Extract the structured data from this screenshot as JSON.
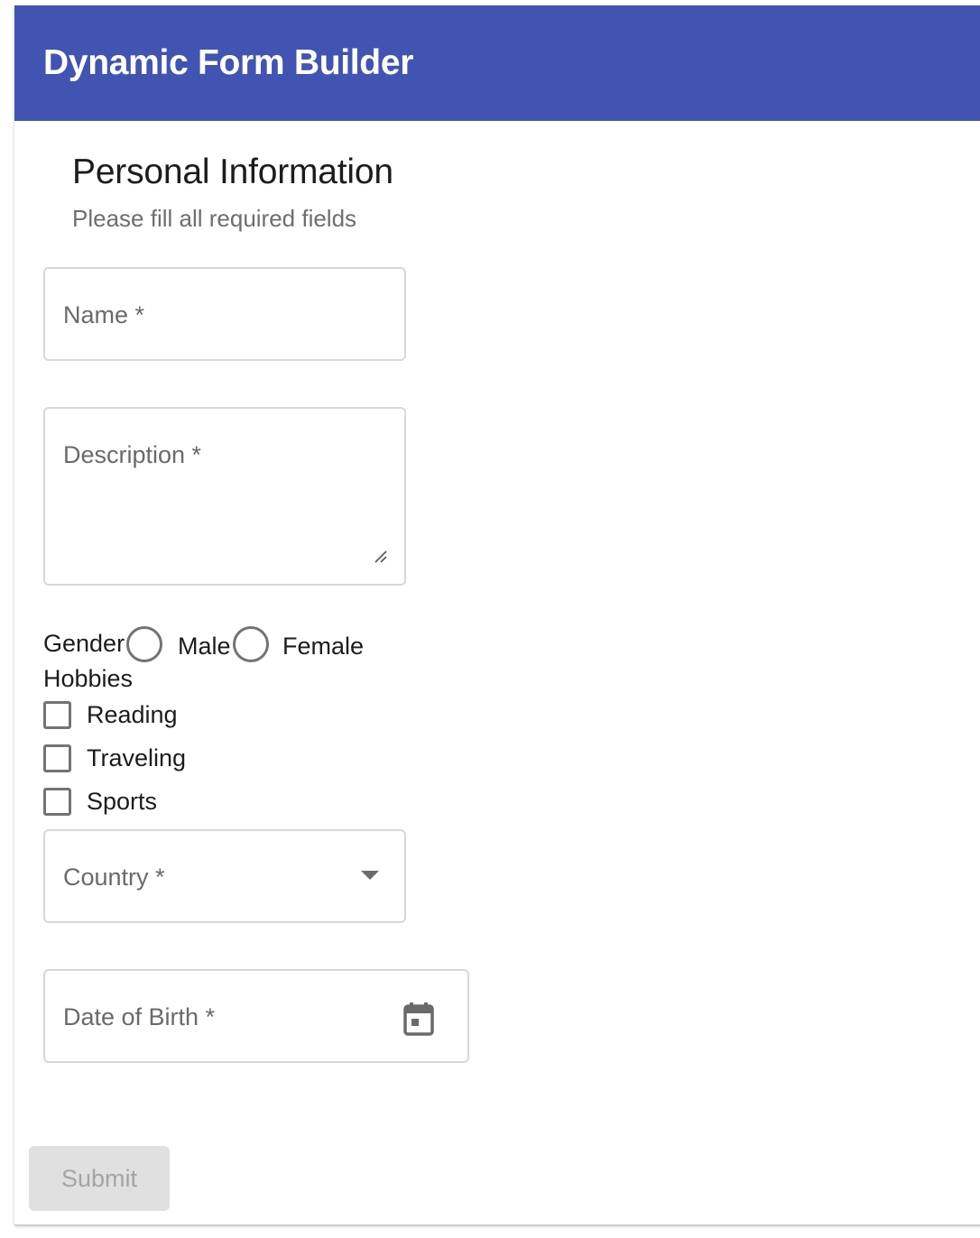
{
  "app": {
    "title": "Dynamic Form Builder"
  },
  "section": {
    "title": "Personal Information",
    "subtitle": "Please fill all required fields"
  },
  "fields": {
    "name": {
      "label": "Name *",
      "value": ""
    },
    "description": {
      "label": "Description *",
      "value": ""
    },
    "country": {
      "label": "Country *",
      "value": ""
    },
    "dob": {
      "label": "Date of Birth *",
      "value": ""
    }
  },
  "gender": {
    "label": "Gender",
    "options": [
      {
        "label": "Male",
        "selected": false
      },
      {
        "label": "Female",
        "selected": false
      }
    ]
  },
  "hobbies": {
    "label": "Hobbies",
    "options": [
      {
        "label": "Reading",
        "checked": false
      },
      {
        "label": "Traveling",
        "checked": false
      },
      {
        "label": "Sports",
        "checked": false
      }
    ]
  },
  "actions": {
    "submit_label": "Submit",
    "submit_disabled": true
  },
  "icons": {
    "dropdown": "chevron-down-icon",
    "calendar": "calendar-icon",
    "resize": "resize-handle-icon"
  },
  "colors": {
    "header": "#4154b1",
    "disabled_button_bg": "#e0e0e0",
    "disabled_button_text": "#a4a4a4"
  }
}
